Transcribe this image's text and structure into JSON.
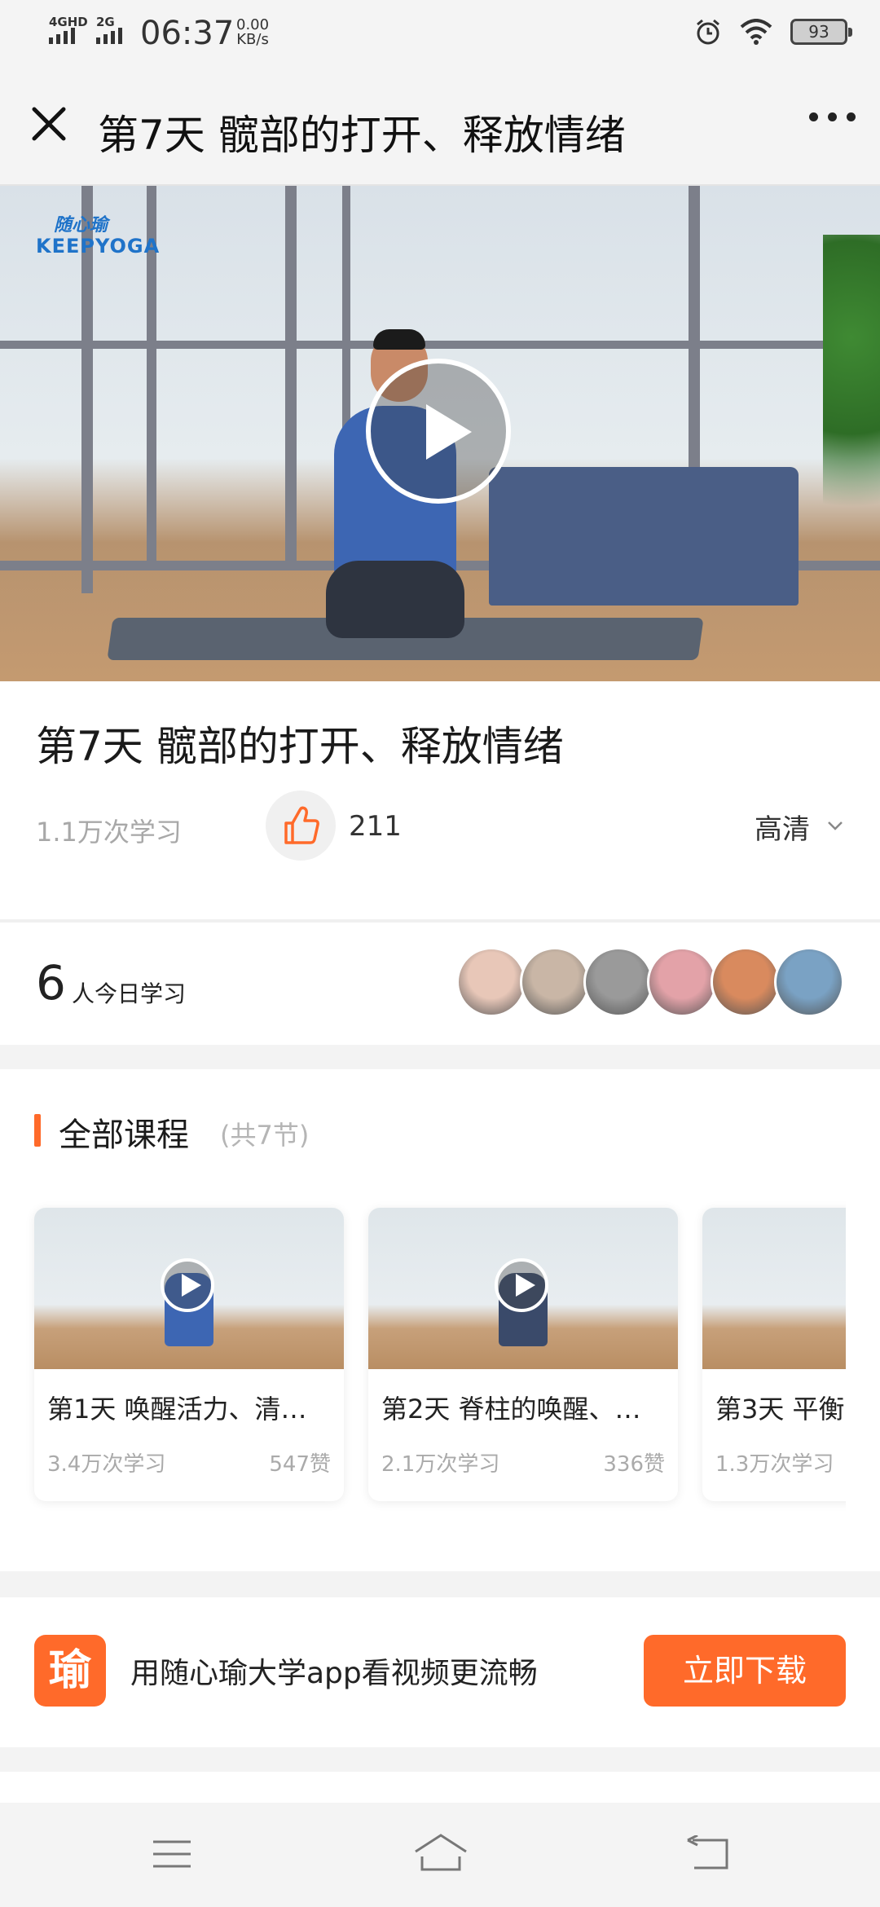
{
  "status_bar": {
    "net1": "4GHD",
    "net2": "2G",
    "time": "06:37",
    "speed_value": "0.00",
    "speed_unit": "KB/s",
    "battery": "93"
  },
  "header": {
    "title": "第7天 髋部的打开、释放情绪"
  },
  "video": {
    "brand_cn": "随心瑜",
    "brand_en": "KEEPYOGA"
  },
  "lesson": {
    "title": "第7天 髋部的打开、释放情绪",
    "views": "1.1万次学习",
    "likes": "211",
    "quality": "高清"
  },
  "today": {
    "count": "6",
    "label": "人今日学习",
    "avatar_colors": [
      "#e8c7b8",
      "#c9b6a6",
      "#9a9a9a",
      "#e3a2a8",
      "#d98a5e",
      "#7aa2c4"
    ]
  },
  "courses": {
    "section_title": "全部课程",
    "count_label": "(共7节)",
    "items": [
      {
        "title": "第1天 唤醒活力、清…",
        "views": "3.4万次学习",
        "likes": "547赞"
      },
      {
        "title": "第2天 脊柱的唤醒、…",
        "views": "2.1万次学习",
        "likes": "336赞"
      },
      {
        "title": "第3天 平衡",
        "views": "1.3万次学习",
        "likes": ""
      }
    ]
  },
  "promo": {
    "icon_text": "瑜",
    "text": "用随心瑜大学app看视频更流畅",
    "button": "立即下载"
  },
  "colors": {
    "accent": "#ff6a2a",
    "gray_text": "#a8a8a8"
  }
}
